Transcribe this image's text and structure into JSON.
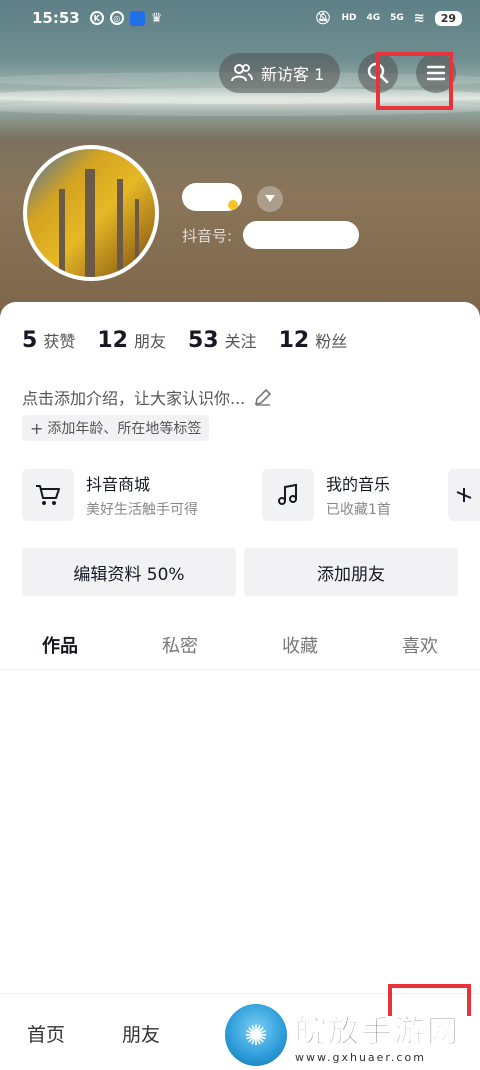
{
  "status_bar": {
    "time": "15:53",
    "signal_labels": [
      "HD",
      "4G",
      "5G"
    ],
    "battery": "29"
  },
  "header": {
    "visitor_label": "新访客 1",
    "douyin_id_label": "抖音号:"
  },
  "stats": [
    {
      "num": "5",
      "label": "获赞"
    },
    {
      "num": "12",
      "label": "朋友"
    },
    {
      "num": "53",
      "label": "关注"
    },
    {
      "num": "12",
      "label": "粉丝"
    }
  ],
  "bio": {
    "placeholder": "点击添加介绍，让大家认识你...",
    "tag_chip": "添加年龄、所在地等标签"
  },
  "services": [
    {
      "title": "抖音商城",
      "subtitle": "美好生活触手可得",
      "icon": "cart-icon"
    },
    {
      "title": "我的音乐",
      "subtitle": "已收藏1首",
      "icon": "music-note-icon"
    }
  ],
  "actions": {
    "edit_profile": "编辑资料 50%",
    "add_friend": "添加朋友"
  },
  "tabs": [
    {
      "label": "作品",
      "active": true
    },
    {
      "label": "私密",
      "active": false
    },
    {
      "label": "收藏",
      "active": false
    },
    {
      "label": "喜欢",
      "active": false
    }
  ],
  "bottom_nav": {
    "home": "首页",
    "friends": "朋友"
  },
  "watermark": {
    "title": "皖放手游网",
    "url": "www.gxhuaer.com"
  },
  "colors": {
    "highlight": "#e8333b",
    "text_primary": "#161823",
    "chip_bg": "#f2f2f4"
  }
}
